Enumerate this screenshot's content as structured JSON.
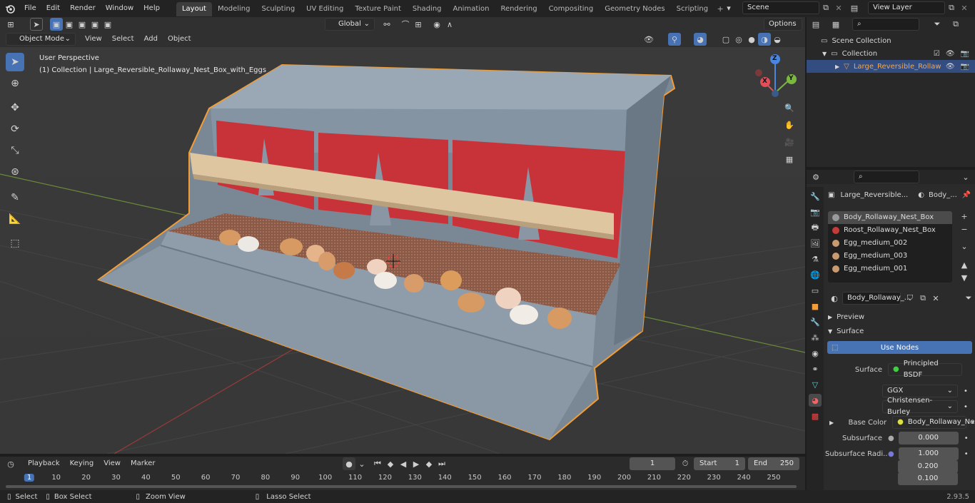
{
  "menu": [
    "File",
    "Edit",
    "Render",
    "Window",
    "Help"
  ],
  "workspaces": [
    "Layout",
    "Modeling",
    "Sculpting",
    "UV Editing",
    "Texture Paint",
    "Shading",
    "Animation",
    "Rendering",
    "Compositing",
    "Geometry Nodes",
    "Scripting"
  ],
  "active_workspace": "Layout",
  "scene": "Scene",
  "view_layer": "View Layer",
  "toolbar": {
    "transform": "Global",
    "options": "Options"
  },
  "viewport_header": {
    "mode": "Object Mode",
    "menus": [
      "View",
      "Select",
      "Add",
      "Object"
    ]
  },
  "viewport": {
    "perspective": "User Perspective",
    "collection_info": "(1) Collection | Large_Reversible_Rollaway_Nest_Box_with_Eggs",
    "gizmo": {
      "x": "X",
      "y": "Y",
      "z": "Z"
    }
  },
  "outliner": {
    "root": "Scene Collection",
    "collection": "Collection",
    "object": "Large_Reversible_Rollaw"
  },
  "properties": {
    "object_name": "Large_Reversible...",
    "material_short": "Body_...",
    "slots": [
      {
        "name": "Body_Rollaway_Nest_Box",
        "color": "#9a9a9a"
      },
      {
        "name": "Roost_Rollaway_Nest_Box",
        "color": "#c83a3a"
      },
      {
        "name": "Egg_medium_002",
        "color": "#c89a70"
      },
      {
        "name": "Egg_medium_003",
        "color": "#c89a70"
      },
      {
        "name": "Egg_medium_001",
        "color": "#c89a70"
      }
    ],
    "material_field": "Body_Rollaway_...",
    "panels": {
      "preview": "Preview",
      "surface": "Surface"
    },
    "use_nodes": "Use Nodes",
    "surface_label": "Surface",
    "surface_value": "Principled BSDF",
    "distribution": "GGX",
    "subsurface_method": "Christensen-Burley",
    "base_color_label": "Base Color",
    "base_color_value": "Body_Rollaway_Nes...",
    "subsurface_label": "Subsurface",
    "subsurface_value": "0.000",
    "subsurface_radius_label": "Subsurface Radi...",
    "subsurface_radius": [
      "1.000",
      "0.200",
      "0.100"
    ]
  },
  "timeline": {
    "menus": [
      "Playback",
      "Keying",
      "View",
      "Marker"
    ],
    "current_frame": "1",
    "start_label": "Start",
    "start": "1",
    "end_label": "End",
    "end": "250",
    "ticks": [
      "1",
      "10",
      "20",
      "30",
      "40",
      "50",
      "60",
      "70",
      "80",
      "90",
      "100",
      "110",
      "120",
      "130",
      "140",
      "150",
      "160",
      "170",
      "180",
      "190",
      "200",
      "210",
      "220",
      "230",
      "240",
      "250"
    ]
  },
  "statusbar": {
    "select": "Select",
    "box_select": "Box Select",
    "zoom_view": "Zoom View",
    "lasso_select": "Lasso Select",
    "version": "2.93.5"
  },
  "colors": {
    "accent": "#4772b3",
    "selection": "#f29d36",
    "roost_red": "#c8333a"
  }
}
